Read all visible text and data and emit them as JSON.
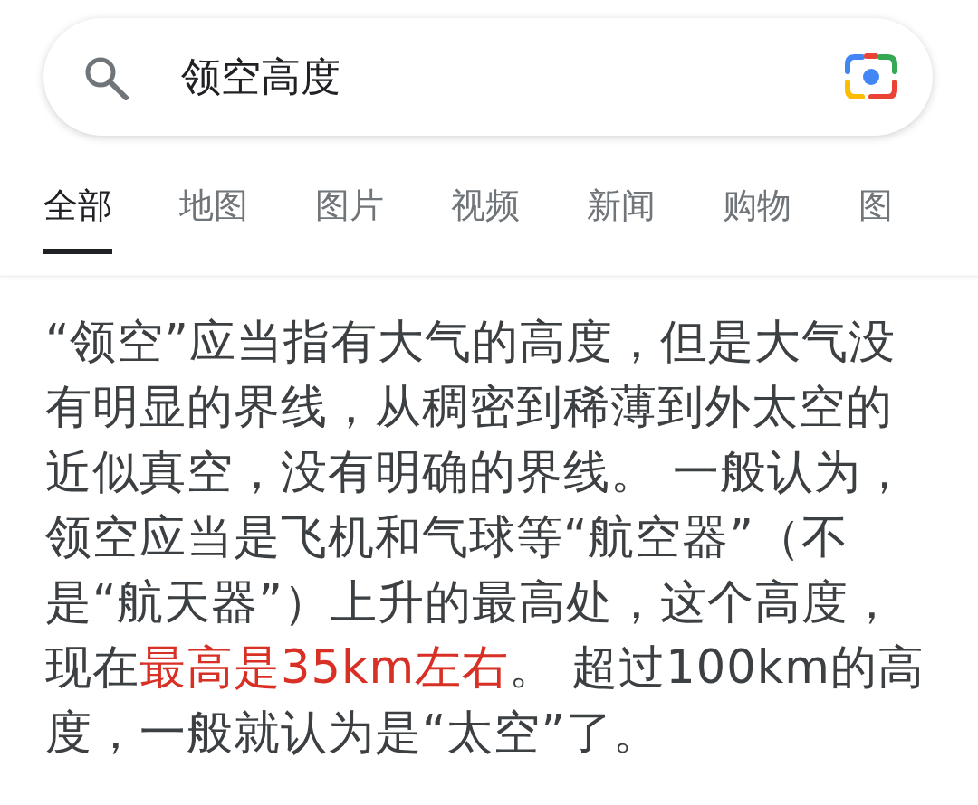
{
  "search": {
    "value": "领空高度"
  },
  "tabs": [
    {
      "label": "全部",
      "selected": true
    },
    {
      "label": "地图",
      "selected": false
    },
    {
      "label": "图片",
      "selected": false
    },
    {
      "label": "视频",
      "selected": false
    },
    {
      "label": "新闻",
      "selected": false
    },
    {
      "label": "购物",
      "selected": false
    },
    {
      "label": "图",
      "selected": false
    }
  ],
  "answer": [
    {
      "text": "“领空”应当指有大气的高度，但是大气没有明显的界线，从稠密到稀薄到外太空的近似真空，没有明确的界线。 一般认为，领空应当是飞机和气球等“航空器”（不是“航天器”）上升的最高处，这个高度，现在",
      "highlight": false
    },
    {
      "text": "最高是35km左右",
      "highlight": true
    },
    {
      "text": "。 超过100km的高度，一般就认为是“太空”了。",
      "highlight": false
    }
  ]
}
